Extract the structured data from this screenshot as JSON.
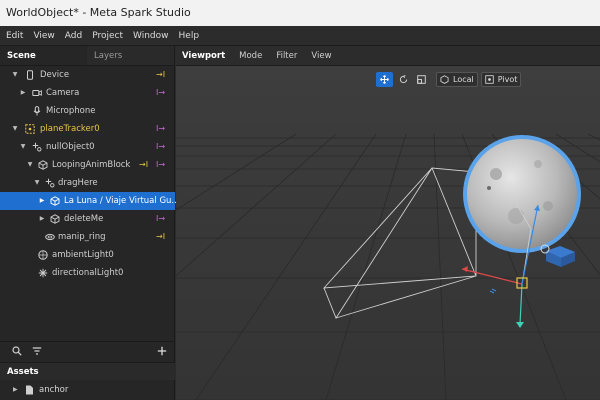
{
  "window": {
    "title": "WorldObject* - Meta Spark Studio"
  },
  "menu": [
    "Edit",
    "View",
    "Add",
    "Project",
    "Window",
    "Help"
  ],
  "left_panel": {
    "tabs": [
      {
        "label": "Scene",
        "active": true
      },
      {
        "label": "Layers",
        "active": false
      }
    ],
    "tree": [
      {
        "label": "Device",
        "arrow": "down",
        "icon": "device-icon",
        "badges": [
          "→I"
        ]
      },
      {
        "label": "Camera",
        "arrow": "right",
        "icon": "camera-icon",
        "badges": [
          "I→"
        ]
      },
      {
        "label": "Microphone",
        "arrow": "",
        "icon": "microphone-icon",
        "badges": []
      },
      {
        "label": "planeTracker0",
        "arrow": "down",
        "icon": "plane-tracker-icon",
        "badges": [
          "I→"
        ]
      },
      {
        "label": "nullObject0",
        "arrow": "down",
        "icon": "null-object-icon",
        "badges": [
          "I→"
        ]
      },
      {
        "label": "LoopingAnimBlock",
        "arrow": "down",
        "icon": "block-icon",
        "badges": [
          "→I",
          "I→"
        ]
      },
      {
        "label": "dragHere",
        "arrow": "down",
        "icon": "null-object-icon",
        "badges": []
      },
      {
        "label": "La Luna / Viaje Virtual Gu...",
        "arrow": "right",
        "icon": "cube-icon",
        "badges": []
      },
      {
        "label": "deleteMe",
        "arrow": "right",
        "icon": "cube-icon",
        "badges": [
          "I→"
        ]
      },
      {
        "label": "manip_ring",
        "arrow": "",
        "icon": "ring-icon",
        "badges": [
          "→I"
        ]
      },
      {
        "label": "ambientLight0",
        "arrow": "",
        "icon": "ambient-light-icon",
        "badges": []
      },
      {
        "label": "directionalLight0",
        "arrow": "",
        "icon": "directional-light-icon",
        "badges": []
      }
    ],
    "assets": {
      "title": "Assets",
      "items": [
        {
          "label": "anchor"
        }
      ]
    }
  },
  "viewport": {
    "tabs": [
      {
        "label": "Viewport",
        "active": true
      },
      {
        "label": "Mode",
        "active": false
      },
      {
        "label": "Filter",
        "active": false
      },
      {
        "label": "View",
        "active": false
      }
    ],
    "toolbar": {
      "local_label": "Local",
      "pivot_label": "Pivot"
    }
  },
  "colors": {
    "selection": "#1e6fd0",
    "yellow_badge": "#e8c84b",
    "purple_badge": "#c76bd6",
    "gizmo_x": "#e04848",
    "gizmo_y": "#3fcfb4",
    "gizmo_z": "#3a8be0"
  }
}
